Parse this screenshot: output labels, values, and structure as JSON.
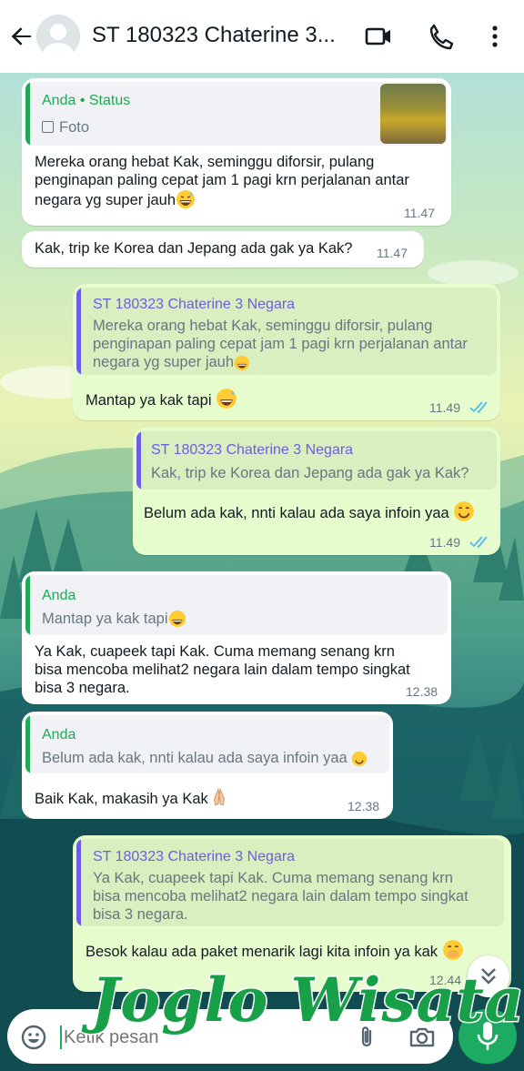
{
  "header": {
    "title": "ST 180323 Chaterine 3...",
    "icons": [
      "back-arrow-icon",
      "avatar",
      "video-call-icon",
      "phone-icon",
      "more-icon"
    ]
  },
  "colors": {
    "accent_green": "#1daa61",
    "incoming_bubble": "#ffffff",
    "outgoing_bubble": "#e7fccd",
    "quote_name_in": "#1fa855",
    "quote_name_out": "#6c5ce7",
    "read_ticks": "#53bdeb"
  },
  "messages": [
    {
      "quote_name": "Anda • Status",
      "quote_text": "Foto",
      "text": "Mereka orang hebat Kak, seminggu diforsir, pulang penginapan paling cepat jam 1 pagi krn perjalanan antar negara yg super jauh",
      "time": "11.47"
    },
    {
      "text": "Kak, trip ke Korea dan Jepang ada gak ya Kak?",
      "time": "11.47"
    },
    {
      "quote_name": "ST 180323 Chaterine 3 Negara",
      "quote_text": "Mereka orang hebat Kak, seminggu diforsir, pulang penginapan paling cepat jam 1 pagi krn perjalanan antar negara yg super jauh",
      "text": "Mantap ya kak tapi",
      "time": "11.49"
    },
    {
      "quote_name": "ST 180323 Chaterine 3 Negara",
      "quote_text": "Kak, trip ke Korea dan Jepang ada gak ya Kak?",
      "text": "Belum ada kak, nnti kalau ada saya infoin yaa",
      "time": "11.49"
    },
    {
      "quote_name": "Anda",
      "quote_text": "Mantap ya kak tapi",
      "text": "Ya Kak, cuapeek tapi Kak. Cuma memang senang krn bisa mencoba melihat2 negara lain dalam tempo singkat bisa 3 negara.",
      "time": "12.38"
    },
    {
      "quote_name": "Anda",
      "quote_text": "Belum ada kak, nnti kalau ada saya infoin yaa",
      "text": "Baik Kak, makasih ya Kak",
      "time": "12.38"
    },
    {
      "quote_name": "ST 180323 Chaterine 3 Negara",
      "quote_text": "Ya Kak, cuapeek tapi Kak. Cuma memang senang krn bisa mencoba melihat2 negara lain dalam tempo singkat bisa 3 negara.",
      "text": "Besok kalau ada paket menarik lagi kita infoin ya kak",
      "time": "12.44"
    }
  ],
  "input": {
    "placeholder": "Ketik pesan"
  },
  "watermark": "Joglo Wisata"
}
